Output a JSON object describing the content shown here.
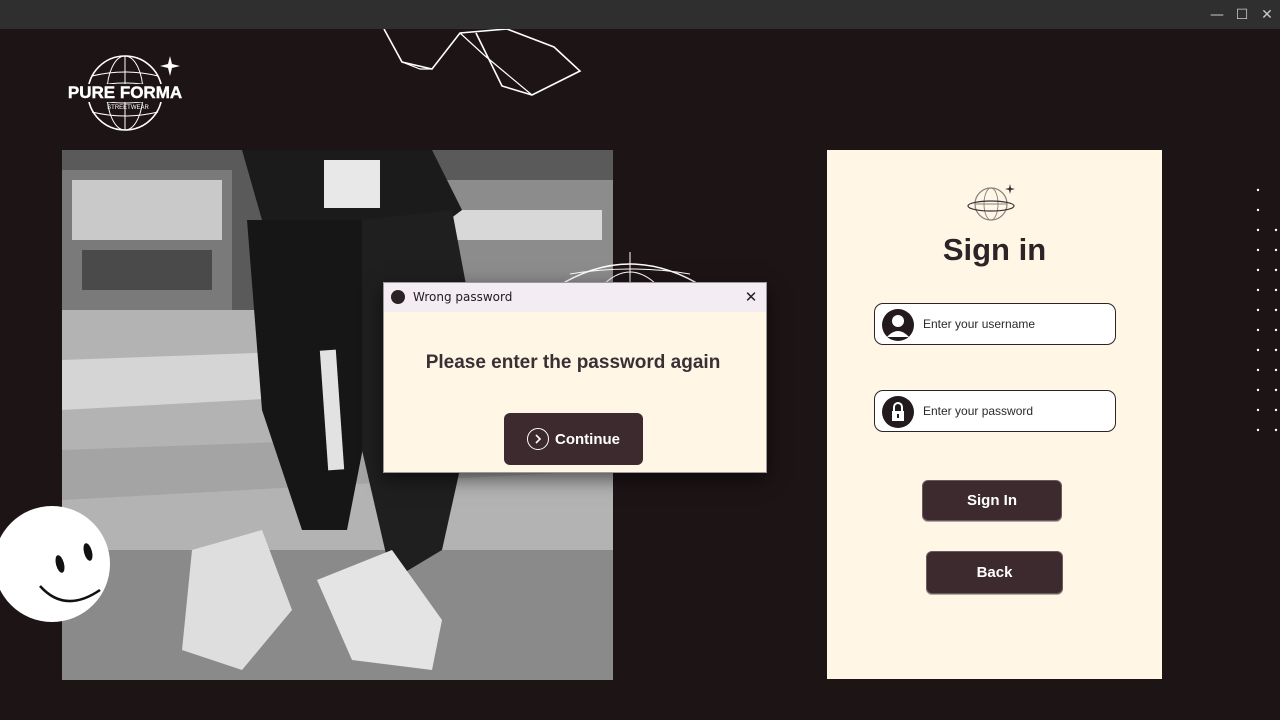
{
  "window": {
    "minimize_glyph": "—",
    "maximize_glyph": "☐",
    "close_glyph": "✕"
  },
  "logo": {
    "brand": "PURE FORMA",
    "tagline": "STREETWEAR"
  },
  "signin": {
    "title": "Sign in",
    "username_placeholder": "Enter your username",
    "password_placeholder": "Enter your password",
    "signin_button": "Sign In",
    "back_button": "Back"
  },
  "dialog": {
    "title": "Wrong password",
    "message": "Please enter the password again",
    "continue_button": "Continue",
    "close_glyph": "✕"
  },
  "colors": {
    "background": "#1d1416",
    "panel": "#fff6e5",
    "button": "#3c2a2f",
    "titlebar": "#2f2f2f"
  }
}
